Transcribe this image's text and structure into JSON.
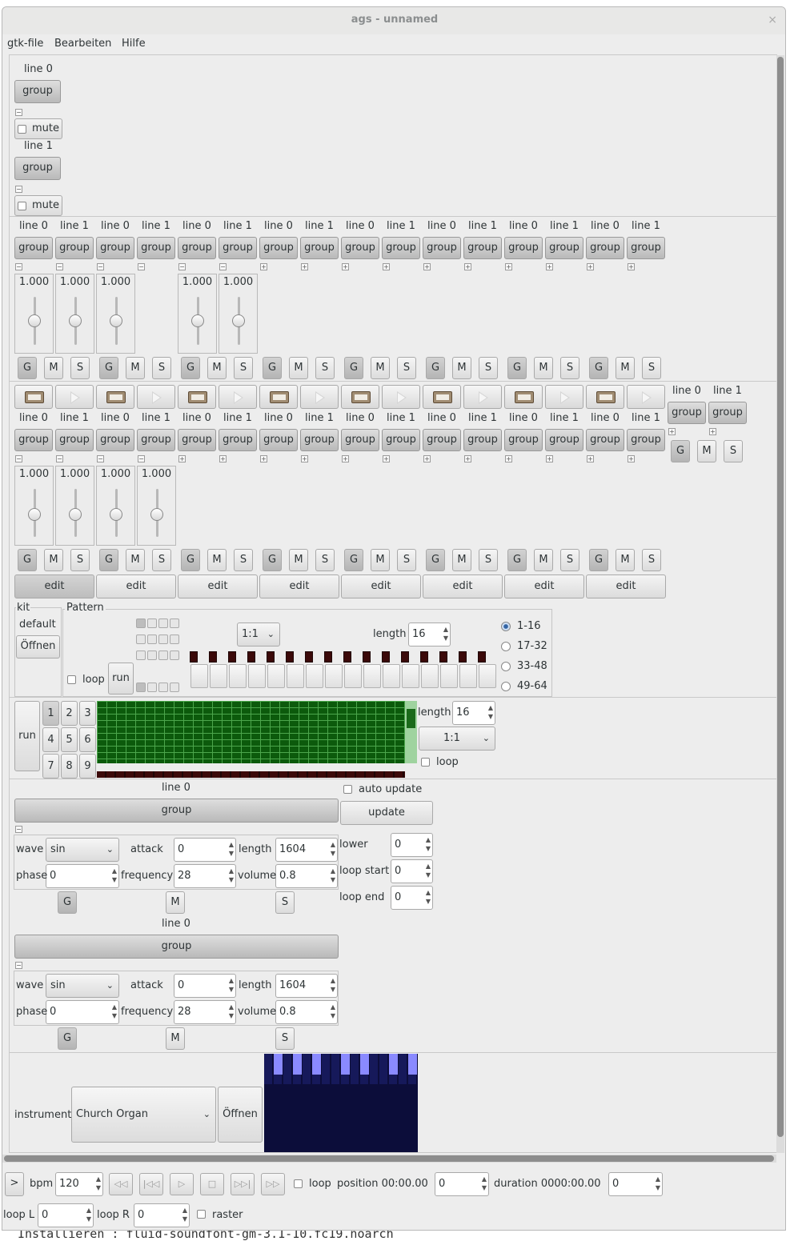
{
  "window": {
    "title": "ags - unnamed",
    "close": "×"
  },
  "menu": [
    "gtk-file",
    "Bearbeiten",
    "Hilfe"
  ],
  "panel": {
    "lines": [
      {
        "name": "line 0",
        "group": "group",
        "mute": "mute"
      },
      {
        "name": "line 1",
        "group": "group",
        "mute": "mute"
      }
    ]
  },
  "mixer": {
    "lines": [
      "line 0",
      "line 1",
      "line 0",
      "line 1",
      "line 0",
      "line 1",
      "line 0",
      "line 1",
      "line 0",
      "line 1",
      "line 0",
      "line 1",
      "line 0",
      "line 1",
      "line 0",
      "line 1"
    ],
    "group": "group",
    "volumes": [
      {
        "col": 0,
        "value": "1.000",
        "level": 0.5
      },
      {
        "col": 1,
        "value": "1.000",
        "level": 0.5
      },
      {
        "col": 2,
        "value": "1.000",
        "level": 0.5
      },
      {
        "col": 4,
        "value": "1.000",
        "level": 0.5
      },
      {
        "col": 5,
        "value": "1.000",
        "level": 0.5
      }
    ],
    "gms": [
      "G",
      "M",
      "S"
    ]
  },
  "drum": {
    "lines": [
      "line 0",
      "line 1",
      "line 0",
      "line 1",
      "line 0",
      "line 1",
      "line 0",
      "line 1",
      "line 0",
      "line 1",
      "line 0",
      "line 1",
      "line 0",
      "line 1",
      "line 0",
      "line 1"
    ],
    "output_lines": [
      "line 0",
      "line 1"
    ],
    "group": "group",
    "volumes": [
      "1.000",
      "1.000",
      "1.000",
      "1.000"
    ],
    "edit": [
      "edit",
      "edit",
      "edit",
      "edit",
      "edit",
      "edit",
      "edit",
      "edit"
    ],
    "kit_label": "kit",
    "kit_default": "default",
    "open": "Öffnen",
    "pattern_label": "Pattern",
    "loop": "loop",
    "run": "run",
    "ratio": "1:1",
    "length_label": "length",
    "length": "16",
    "offsets": [
      "1-16",
      "17-32",
      "33-48",
      "49-64"
    ]
  },
  "matrix": {
    "run": "run",
    "numbers": [
      "1",
      "2",
      "3",
      "4",
      "5",
      "6",
      "7",
      "8",
      "9"
    ],
    "length_label": "length",
    "length": "16",
    "ratio": "1:1",
    "loop": "loop"
  },
  "synth": {
    "auto_update": "auto update",
    "update": "update",
    "lower_label": "lower",
    "lower": "0",
    "loop_start_label": "loop start",
    "loop_start": "0",
    "loop_end_label": "loop end",
    "loop_end": "0",
    "oscillators": [
      {
        "line": "line 0",
        "group": "group",
        "wave_label": "wave",
        "wave": "sin",
        "attack_label": "attack",
        "attack": "0",
        "length_label": "length",
        "length": "1604",
        "phase_label": "phase",
        "phase": "0",
        "frequency_label": "frequency",
        "frequency": "28",
        "volume_label": "volume",
        "volume": "0.8"
      },
      {
        "line": "line 0",
        "group": "group",
        "wave_label": "wave",
        "wave": "sin",
        "attack_label": "attack",
        "attack": "0",
        "length_label": "length",
        "length": "1604",
        "phase_label": "phase",
        "phase": "0",
        "frequency_label": "frequency",
        "frequency": "28",
        "volume_label": "volume",
        "volume": "0.8"
      }
    ]
  },
  "ffplayer": {
    "instrument_label": "instrument",
    "instrument": "Church Organ",
    "open": "Öffnen"
  },
  "navigation": {
    "expander": ">",
    "bpm_label": "bpm",
    "bpm": "120",
    "loop": "loop",
    "position_label": "position 00:00.00",
    "position": "0",
    "duration_label": "duration 0000:00.00",
    "duration": "0",
    "loop_l_label": "loop L",
    "loop_l": "0",
    "loop_r_label": "loop R",
    "loop_r": "0",
    "raster": "raster"
  },
  "background_terminal_text": "Installieren     : fluid-soundfont-gm-3.1-10.fc19.noarch"
}
